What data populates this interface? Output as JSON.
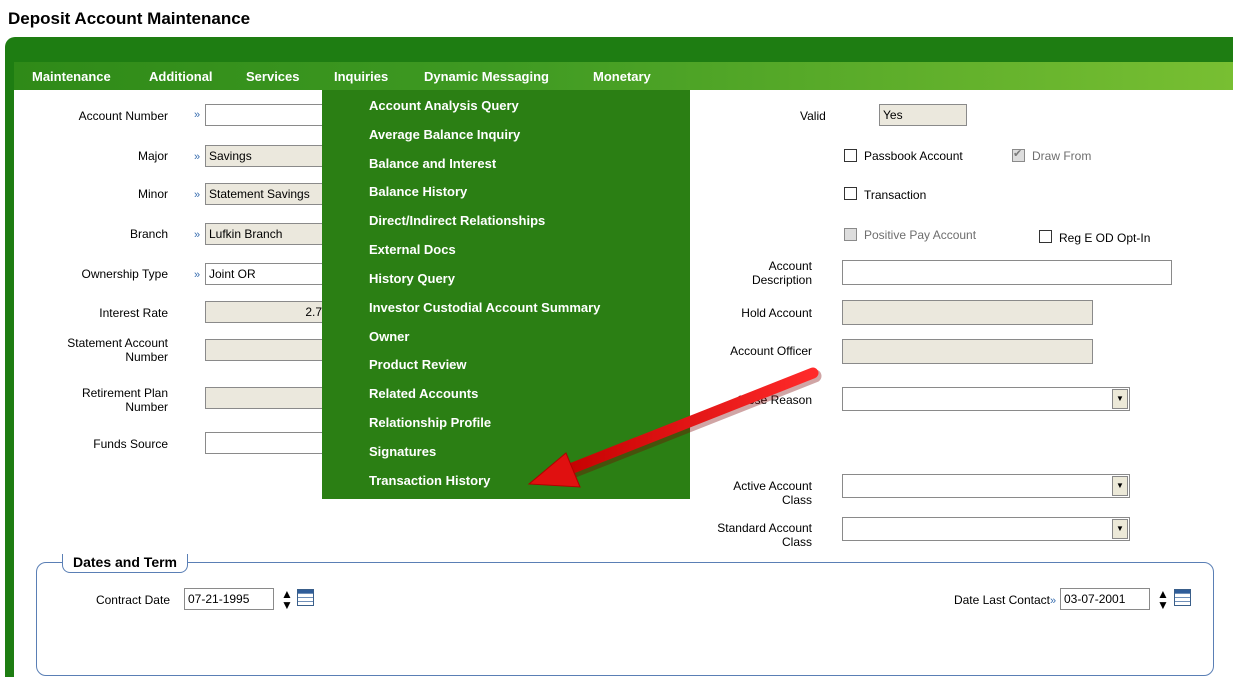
{
  "page": {
    "title": "Deposit Account Maintenance"
  },
  "menu": [
    {
      "label": "Maintenance"
    },
    {
      "label": "Additional"
    },
    {
      "label": "Services"
    },
    {
      "label": "Inquiries"
    },
    {
      "label": "Dynamic Messaging"
    },
    {
      "label": "Monetary"
    }
  ],
  "dropdown": {
    "items": [
      "Account Analysis Query",
      "Average Balance Inquiry",
      "Balance and Interest",
      "Balance History",
      "Direct/Indirect Relationships",
      "External Docs",
      "History Query",
      "Investor Custodial Account Summary",
      "Owner",
      "Product Review",
      "Related Accounts",
      "Relationship Profile",
      "Signatures",
      "Transaction History"
    ]
  },
  "left": {
    "account_number": {
      "label": "Account Number",
      "value": ""
    },
    "major": {
      "label": "Major",
      "value": "Savings"
    },
    "minor": {
      "label": "Minor",
      "value": "Statement Savings"
    },
    "branch": {
      "label": "Branch",
      "value": "Lufkin Branch"
    },
    "ownership": {
      "label": "Ownership Type",
      "value": "Joint OR"
    },
    "interest": {
      "label": "Interest Rate",
      "value": "2.7"
    },
    "statement_label_1": "Statement Account",
    "statement_label_2": "Number",
    "retirement_label_1": "Retirement Plan",
    "retirement_label_2": "Number",
    "funds": {
      "label": "Funds Source",
      "value": ""
    }
  },
  "right": {
    "valid": {
      "label": "Valid",
      "value": "Yes"
    },
    "passbook": "Passbook Account",
    "draw_from": "Draw From",
    "transaction": "Transaction",
    "positive_pay": "Positive Pay Account",
    "reg_e": "Reg E OD Opt-In",
    "desc_label_1": "Account",
    "desc_label_2": "Description",
    "hold": "Hold Account",
    "officer": "Account Officer",
    "close_reason": "Close Reason",
    "active_class_1": "Active Account",
    "active_class_2": "Class",
    "standard_class_1": "Standard Account",
    "standard_class_2": "Class"
  },
  "dates": {
    "legend": "Dates and Term",
    "contract_label": "Contract Date",
    "contract_value": "07-21-1995",
    "last_contact_label": "Date Last Contact",
    "last_contact_value": "03-07-2001"
  },
  "colors": {
    "menu_green": "#2b7f14",
    "frame_green": "#1e7d12",
    "arrow_red": "#e01010"
  }
}
